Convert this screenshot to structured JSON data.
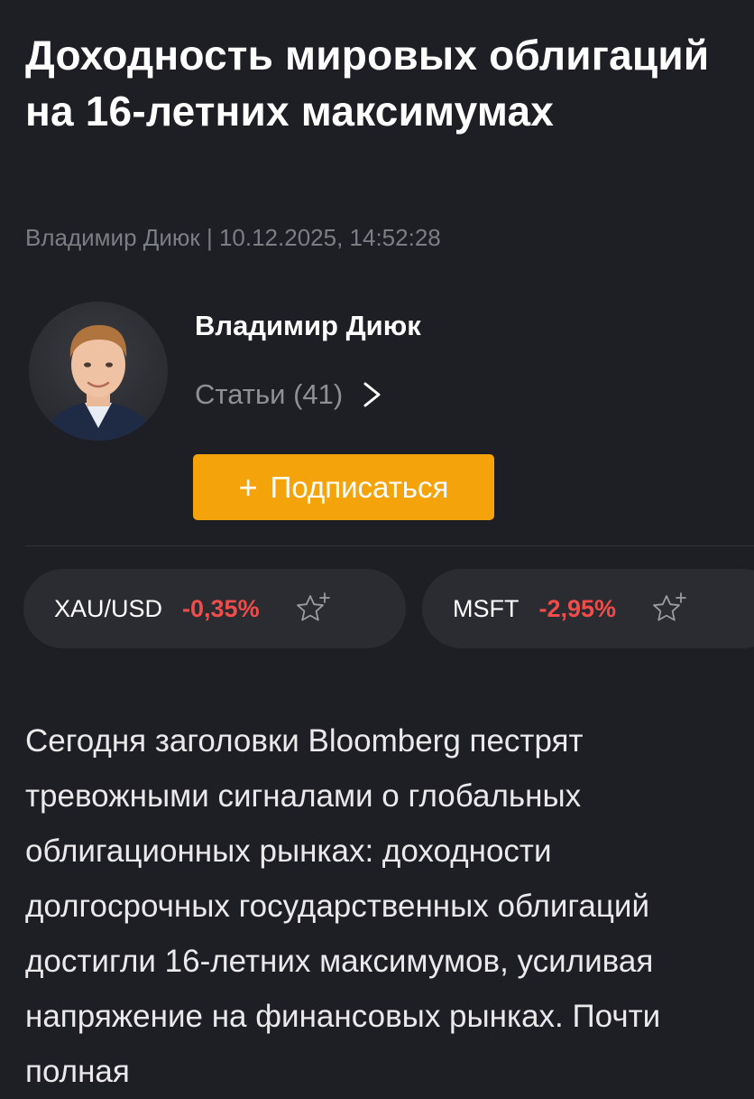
{
  "article": {
    "title": "Доходность мировых облигаций на 16-летних максимумах",
    "byline": "Владимир Диюк | 10.12.2025, 14:52:28",
    "body": "Сегодня заголовки Bloomberg пестрят тревожными сигналами о глобальных облигационных рынках: доходности долгосрочных государственных облигаций достигли 16-летних максимумов, усиливая напряжение на финансовых рынках. Почти полная"
  },
  "author": {
    "name": "Владимир Диюк",
    "articles_label": "Статьи (41)",
    "subscribe_label": "Подписаться",
    "icons": {
      "avatar": "author-photo",
      "articles_arrow": "chevron-right-icon",
      "subscribe": "plus-icon"
    }
  },
  "tickers": [
    {
      "symbol": "XAU/USD",
      "change": "-0,35%",
      "icon": "star-plus-icon"
    },
    {
      "symbol": "MSFT",
      "change": "-2,95%",
      "icon": "star-plus-icon"
    }
  ],
  "colors": {
    "background": "#1e1f24",
    "accent": "#f5a30a",
    "negative": "#ef4c4a",
    "muted": "#7c7e85",
    "chip": "#2a2c31"
  }
}
